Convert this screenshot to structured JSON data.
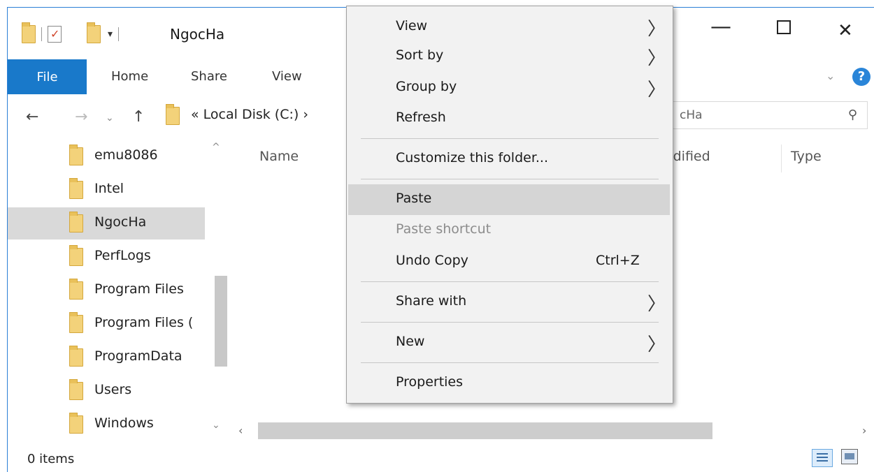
{
  "window": {
    "title": "NgocHa",
    "controls": {
      "minimize": "—",
      "maximize": "",
      "close": "✕"
    }
  },
  "ribbon": {
    "tabs": [
      {
        "label": "File",
        "active": true
      },
      {
        "label": "Home"
      },
      {
        "label": "Share"
      },
      {
        "label": "View"
      }
    ],
    "help": "?",
    "expand": "⌄"
  },
  "address": {
    "back": "←",
    "forward": "→",
    "recent": "⌄",
    "up": "↑",
    "path": "« Local Disk (C:) ›",
    "search_text": "cHa",
    "search_icon": "⚲"
  },
  "nav_pane": {
    "items": [
      {
        "label": "emu8086"
      },
      {
        "label": "Intel"
      },
      {
        "label": "NgocHa",
        "selected": true
      },
      {
        "label": "PerfLogs"
      },
      {
        "label": "Program Files"
      },
      {
        "label": "Program Files ("
      },
      {
        "label": "ProgramData"
      },
      {
        "label": "Users"
      },
      {
        "label": "Windows"
      }
    ],
    "scroll_up": "^",
    "scroll_down": "⌄"
  },
  "content": {
    "columns": {
      "name": "Name",
      "modified": "odified",
      "type": "Type"
    },
    "hscroll_left": "‹",
    "hscroll_right": "›"
  },
  "status_bar": {
    "items_text": "0 items"
  },
  "context_menu": {
    "items": [
      {
        "label": "View",
        "submenu": true
      },
      {
        "label": "Sort by",
        "submenu": true
      },
      {
        "label": "Group by",
        "submenu": true
      },
      {
        "label": "Refresh"
      },
      {
        "label": "Customize this folder..."
      },
      {
        "label": "Paste",
        "highlighted": true
      },
      {
        "label": "Paste shortcut",
        "disabled": true
      },
      {
        "label": "Undo Copy",
        "shortcut": "Ctrl+Z"
      },
      {
        "label": "Share with",
        "submenu": true
      },
      {
        "label": "New",
        "submenu": true
      },
      {
        "label": "Properties"
      }
    ],
    "submenu_arrow": "〉"
  },
  "colors": {
    "accent": "#1979ca",
    "menu_bg": "#f2f2f2",
    "menu_highlight": "#d5d5d5",
    "selection": "#d9d9d9",
    "folder": "#f3d27a"
  }
}
